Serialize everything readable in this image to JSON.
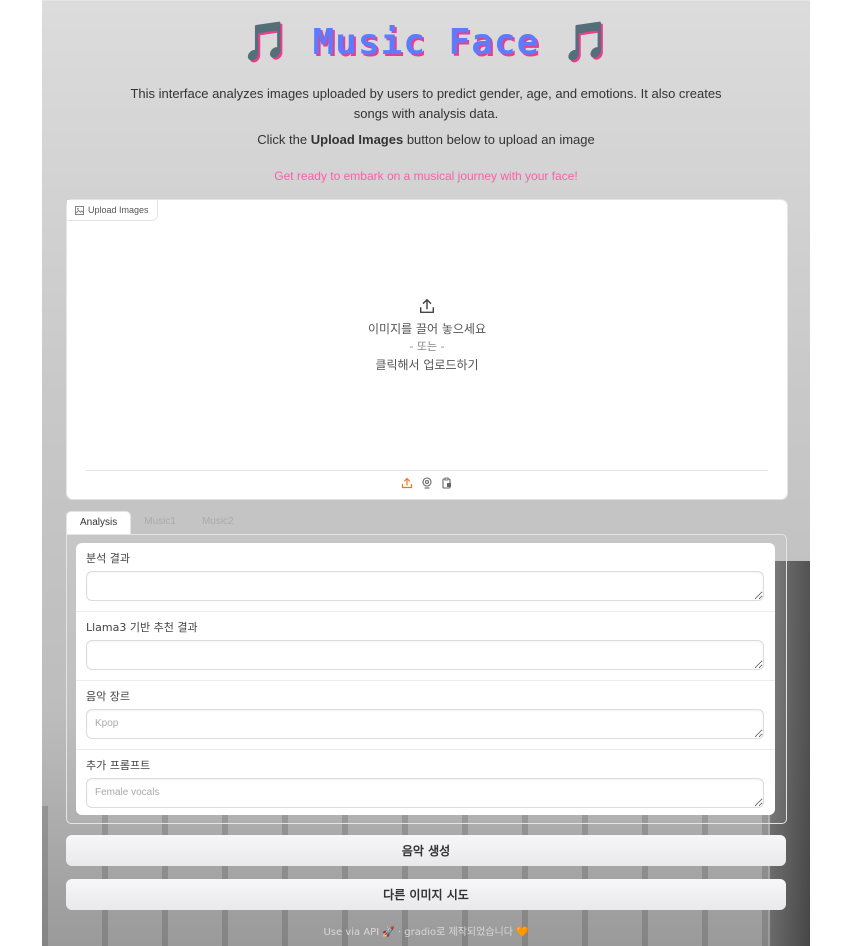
{
  "header": {
    "note_left": "🎵",
    "title": "Music Face",
    "note_right": "🎵",
    "description": "This interface analyzes images uploaded by users to predict gender, age, and emotions. It also creates songs with analysis data.",
    "instruction_prefix": "Click the ",
    "instruction_bold": "Upload Images",
    "instruction_suffix": " button below to upload an image",
    "tagline": "Get ready to embark on a musical journey with your face!"
  },
  "upload": {
    "label": "Upload Images",
    "drop_text": "이미지를 끌어 놓으세요",
    "or_text": "- 또는 -",
    "click_text": "클릭해서 업로드하기"
  },
  "tabs": [
    {
      "label": "Analysis"
    },
    {
      "label": "Music1"
    },
    {
      "label": "Music2"
    }
  ],
  "fields": [
    {
      "label": "분석 결과",
      "placeholder": ""
    },
    {
      "label": "Llama3 기반 추천 결과",
      "placeholder": ""
    },
    {
      "label": "음악 장르",
      "placeholder": "Kpop"
    },
    {
      "label": "추가 프롬프트",
      "placeholder": "Female vocals"
    }
  ],
  "buttons": {
    "generate": "음악 생성",
    "retry": "다른 이미지 시도"
  },
  "footer": {
    "text": "Use via API 🚀 · gradio로 제작되었습니다 🧡"
  },
  "colors": {
    "title": "#5b7cff",
    "title_shadow": "#e83e8c",
    "tagline": "#ff5ca8",
    "upload_icon": "#f97316"
  }
}
